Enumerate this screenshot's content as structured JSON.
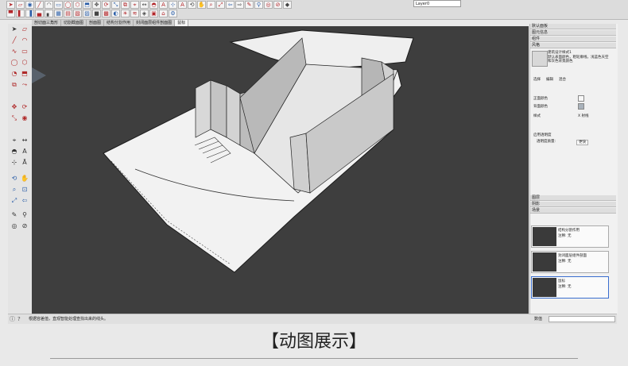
{
  "toolbar": {
    "icons": [
      "select-icon",
      "eraser-icon",
      "paint-icon",
      "line-icon",
      "arc-icon",
      "rectangle-icon",
      "circle-icon",
      "polygon-icon",
      "pushpull-icon",
      "move-icon",
      "rotate-icon",
      "scale-icon",
      "offset-icon",
      "tape-icon",
      "dimension-icon",
      "protractor-icon",
      "text-icon",
      "axes-icon",
      "3dtext-icon",
      "orbit-icon",
      "pan-icon",
      "zoom-icon",
      "zoom-extents-icon",
      "previous-icon",
      "next-icon",
      "position-camera-icon",
      "walk-icon",
      "lookaround-icon",
      "section-icon",
      "iso-icon",
      "top-icon",
      "front-icon",
      "right-icon",
      "back-icon",
      "left-icon",
      "xray-icon",
      "backedges-icon",
      "wireframe-icon",
      "hiddenline-icon",
      "shaded-icon",
      "textured-icon",
      "monochrome-icon",
      "shadows-icon",
      "fog-icon",
      "component-icon",
      "group-icon",
      "warehouse-icon",
      "extension-icon"
    ],
    "layer_select": "Layer0"
  },
  "tabs": [
    "剖切面三角形",
    "切割截面图",
    "剖面图",
    "结构分割作用",
    "封闭面层组件剖面图",
    "鼠标"
  ],
  "status": {
    "text": "根据容差值，直观智能处理查找出来的线头。",
    "value_label": "数值"
  },
  "right_panel": {
    "sections": [
      "默认面板",
      "图元信息",
      "组件",
      "风格"
    ],
    "style_name": "建筑设计样式1",
    "style_desc": "默认表面颜色，粗轮廓线，浅蓝色天空和灰色背景颜色",
    "style_tabs": [
      "选择",
      "编辑",
      "混合"
    ],
    "face_label": "正面颜色",
    "back_label": "背面颜色",
    "style_label": "样式",
    "edge_label": "X 射线",
    "transparency_check": "启用透明度",
    "transparency_quality": "透明度质量:",
    "quality_value": "更快",
    "lower_sections": [
      "图层",
      "阴影",
      "场景"
    ],
    "scenes": [
      {
        "name": "结构分割作用",
        "note": "注释: 无"
      },
      {
        "name": "封闭面层组件剖面",
        "note": "注释: 无"
      },
      {
        "name": "鼠标",
        "note": "注释: 无"
      }
    ]
  },
  "caption": "【动图展示】",
  "colors": {
    "viewport_bg": "#3e3e3e",
    "model_face": "#f2f2f2",
    "wall_dark": "#bdbdbd",
    "accent_red": "#b3262a"
  }
}
